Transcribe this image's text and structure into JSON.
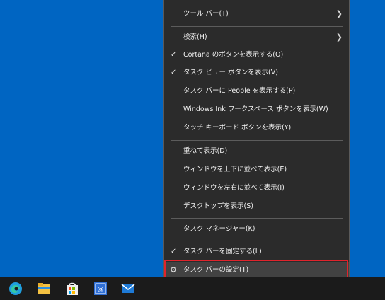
{
  "context_menu": {
    "items": [
      {
        "label": "ツール バー(T)"
      },
      {
        "label": "検索(H)"
      },
      {
        "label": "Cortana のボタンを表示する(O)"
      },
      {
        "label": "タスク ビュー ボタンを表示(V)"
      },
      {
        "label": "タスク バーに People を表示する(P)"
      },
      {
        "label": "Windows Ink ワークスペース ボタンを表示(W)"
      },
      {
        "label": "タッチ キーボード ボタンを表示(Y)"
      },
      {
        "label": "重ねて表示(D)"
      },
      {
        "label": "ウィンドウを上下に並べて表示(E)"
      },
      {
        "label": "ウィンドウを左右に並べて表示(I)"
      },
      {
        "label": "デスクトップを表示(S)"
      },
      {
        "label": "タスク マネージャー(K)"
      },
      {
        "label": "タスク バーを固定する(L)"
      },
      {
        "label": "タスク バーの設定(T)"
      }
    ]
  },
  "colors": {
    "desktop": "#0065c2",
    "menu_bg": "#2b2b2b",
    "highlight_border": "#e0242c"
  },
  "taskbar": {
    "icons": [
      "edge-icon",
      "file-explorer-icon",
      "store-icon",
      "mail-app-icon",
      "mail-icon"
    ]
  }
}
